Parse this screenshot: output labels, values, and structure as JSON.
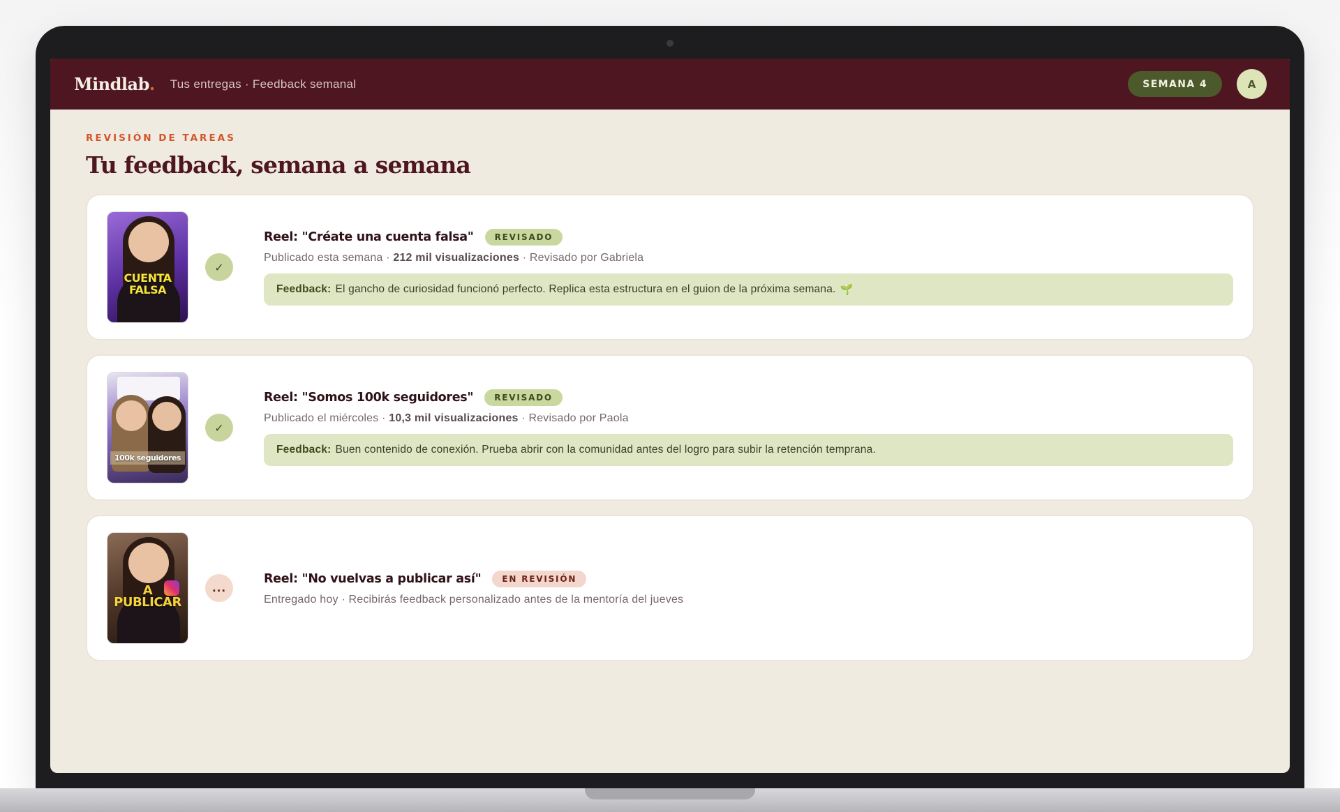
{
  "header": {
    "brand": "Mindlab",
    "brand_dot": ".",
    "subtitle": "Tus entregas · Feedback semanal",
    "week_badge": "SEMANA 4",
    "avatar_initial": "A"
  },
  "main": {
    "eyebrow": "REVISIÓN DE TAREAS",
    "title": "Tu feedback, semana a semana"
  },
  "cards": [
    {
      "thumb_caption": "CUENTA FALSA",
      "status_icon": "✓",
      "title": "Reel: \"Créate una cuenta falsa\"",
      "tag": "REVISADO",
      "meta_prefix": "Publicado esta semana · ",
      "meta_views": "212 mil visualizaciones",
      "meta_suffix": " · Revisado por Gabriela",
      "feedback_label": "Feedback:",
      "feedback_text": "El gancho de curiosidad funcionó perfecto. Replica esta estructura en el guion de la próxima semana.",
      "feedback_icon": "🌱"
    },
    {
      "thumb_caption": "100k seguidores",
      "status_icon": "✓",
      "title": "Reel: \"Somos 100k seguidores\"",
      "tag": "REVISADO",
      "meta_prefix": "Publicado el miércoles · ",
      "meta_views": "10,3 mil visualizaciones",
      "meta_suffix": " · Revisado por Paola",
      "feedback_label": "Feedback:",
      "feedback_text": "Buen contenido de conexión. Prueba abrir con la comunidad antes del logro para subir la retención temprana."
    },
    {
      "thumb_caption": "A PUBLICAR",
      "status_icon": "...",
      "title": "Reel: \"No vuelvas a publicar así\"",
      "tag": "EN REVISIÓN",
      "meta": "Entregado hoy · Recibirás feedback personalizado antes de la mentoría del jueves"
    }
  ],
  "colors": {
    "header_bg": "#4e1620",
    "accent": "#d4552a",
    "week_badge_bg": "#4c5a2b",
    "screen_bg": "#f0ebe1",
    "feedback_bg": "#dee6c3",
    "reviewed_tag_bg": "#c9d89f",
    "pending_tag_bg": "#f3d6cc"
  },
  "icons": {
    "reviewed_status": "check-icon",
    "pending_status": "ellipsis-icon",
    "feedback_emoji": "sprout-icon"
  }
}
